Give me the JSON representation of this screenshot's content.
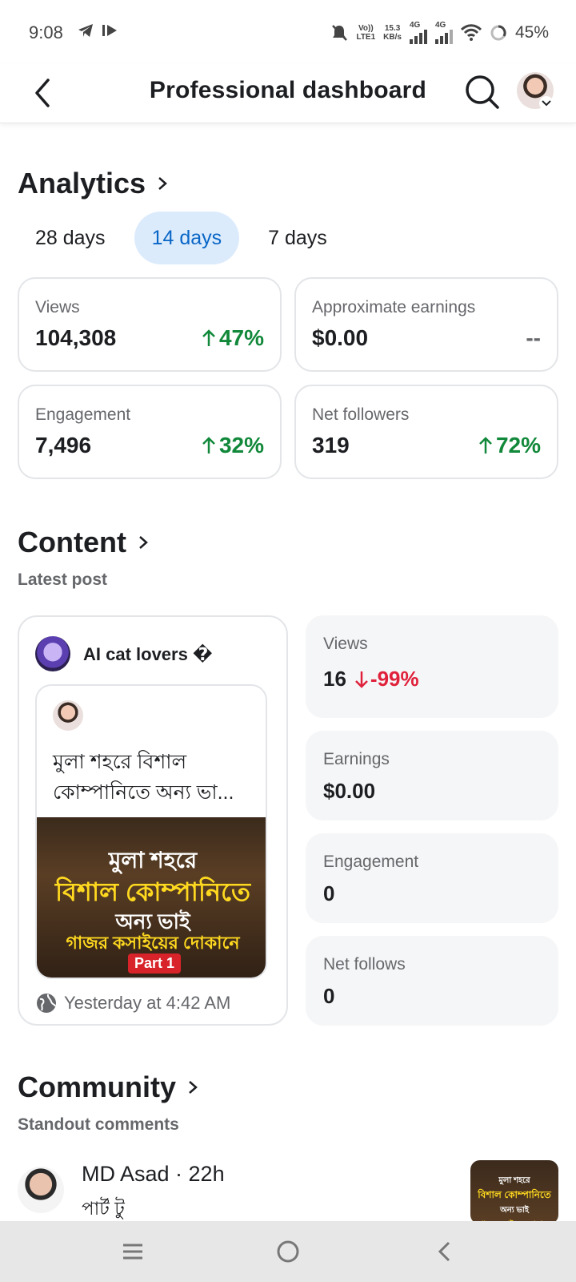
{
  "status_bar": {
    "time": "9:08",
    "network_top": "Vo))",
    "network_bottom": "LTE1",
    "speed_top": "15.3",
    "speed_bottom": "KB/s",
    "sim1": "4G",
    "sim2": "4G",
    "battery": "45%"
  },
  "header": {
    "title": "Professional dashboard"
  },
  "analytics": {
    "title": "Analytics",
    "tabs": [
      {
        "label": "28 days",
        "active": false
      },
      {
        "label": "14 days",
        "active": true
      },
      {
        "label": "7 days",
        "active": false
      }
    ],
    "cards": [
      {
        "label": "Views",
        "value": "104,308",
        "trend": "47%",
        "direction": "up"
      },
      {
        "label": "Approximate earnings",
        "value": "$0.00",
        "trend": "--",
        "direction": "none"
      },
      {
        "label": "Engagement",
        "value": "7,496",
        "trend": "32%",
        "direction": "up"
      },
      {
        "label": "Net followers",
        "value": "319",
        "trend": "72%",
        "direction": "up"
      }
    ]
  },
  "content": {
    "title": "Content",
    "subtitle": "Latest post",
    "post": {
      "page_name": "AI cat lovers �",
      "text": "মুলা শহরে বিশাল কোম্পানিতে অন্য ভা...",
      "thumbnail": {
        "line1": "মুলা শহরে",
        "line2": "বিশাল কোম্পানিতে",
        "line3": "অন্য ভাই",
        "line4": "গাজর কসাইয়ের দোকানে",
        "badge": "Part 1"
      },
      "time": "Yesterday at 4:42 AM"
    },
    "stats": [
      {
        "label": "Views",
        "value": "16",
        "trend": "-99%",
        "direction": "down"
      },
      {
        "label": "Earnings",
        "value": "$0.00"
      },
      {
        "label": "Engagement",
        "value": "0"
      },
      {
        "label": "Net follows",
        "value": "0"
      }
    ]
  },
  "community": {
    "title": "Community",
    "subtitle": "Standout comments",
    "comment": {
      "author": "MD Asad · 22h",
      "text": "পার্ট টু",
      "thumb_line1": "মুলা শহরে",
      "thumb_line2": "বিশাল কোম্পানিতে",
      "thumb_line3": "অন্য ভাই",
      "thumb_line4": "গাজর কসাইয়ের দোকানে"
    }
  },
  "colors": {
    "accent_blue": "#0866c6",
    "tab_active_bg": "#dcebfc",
    "positive_green": "#11883a",
    "negative_red": "#e0213b"
  }
}
